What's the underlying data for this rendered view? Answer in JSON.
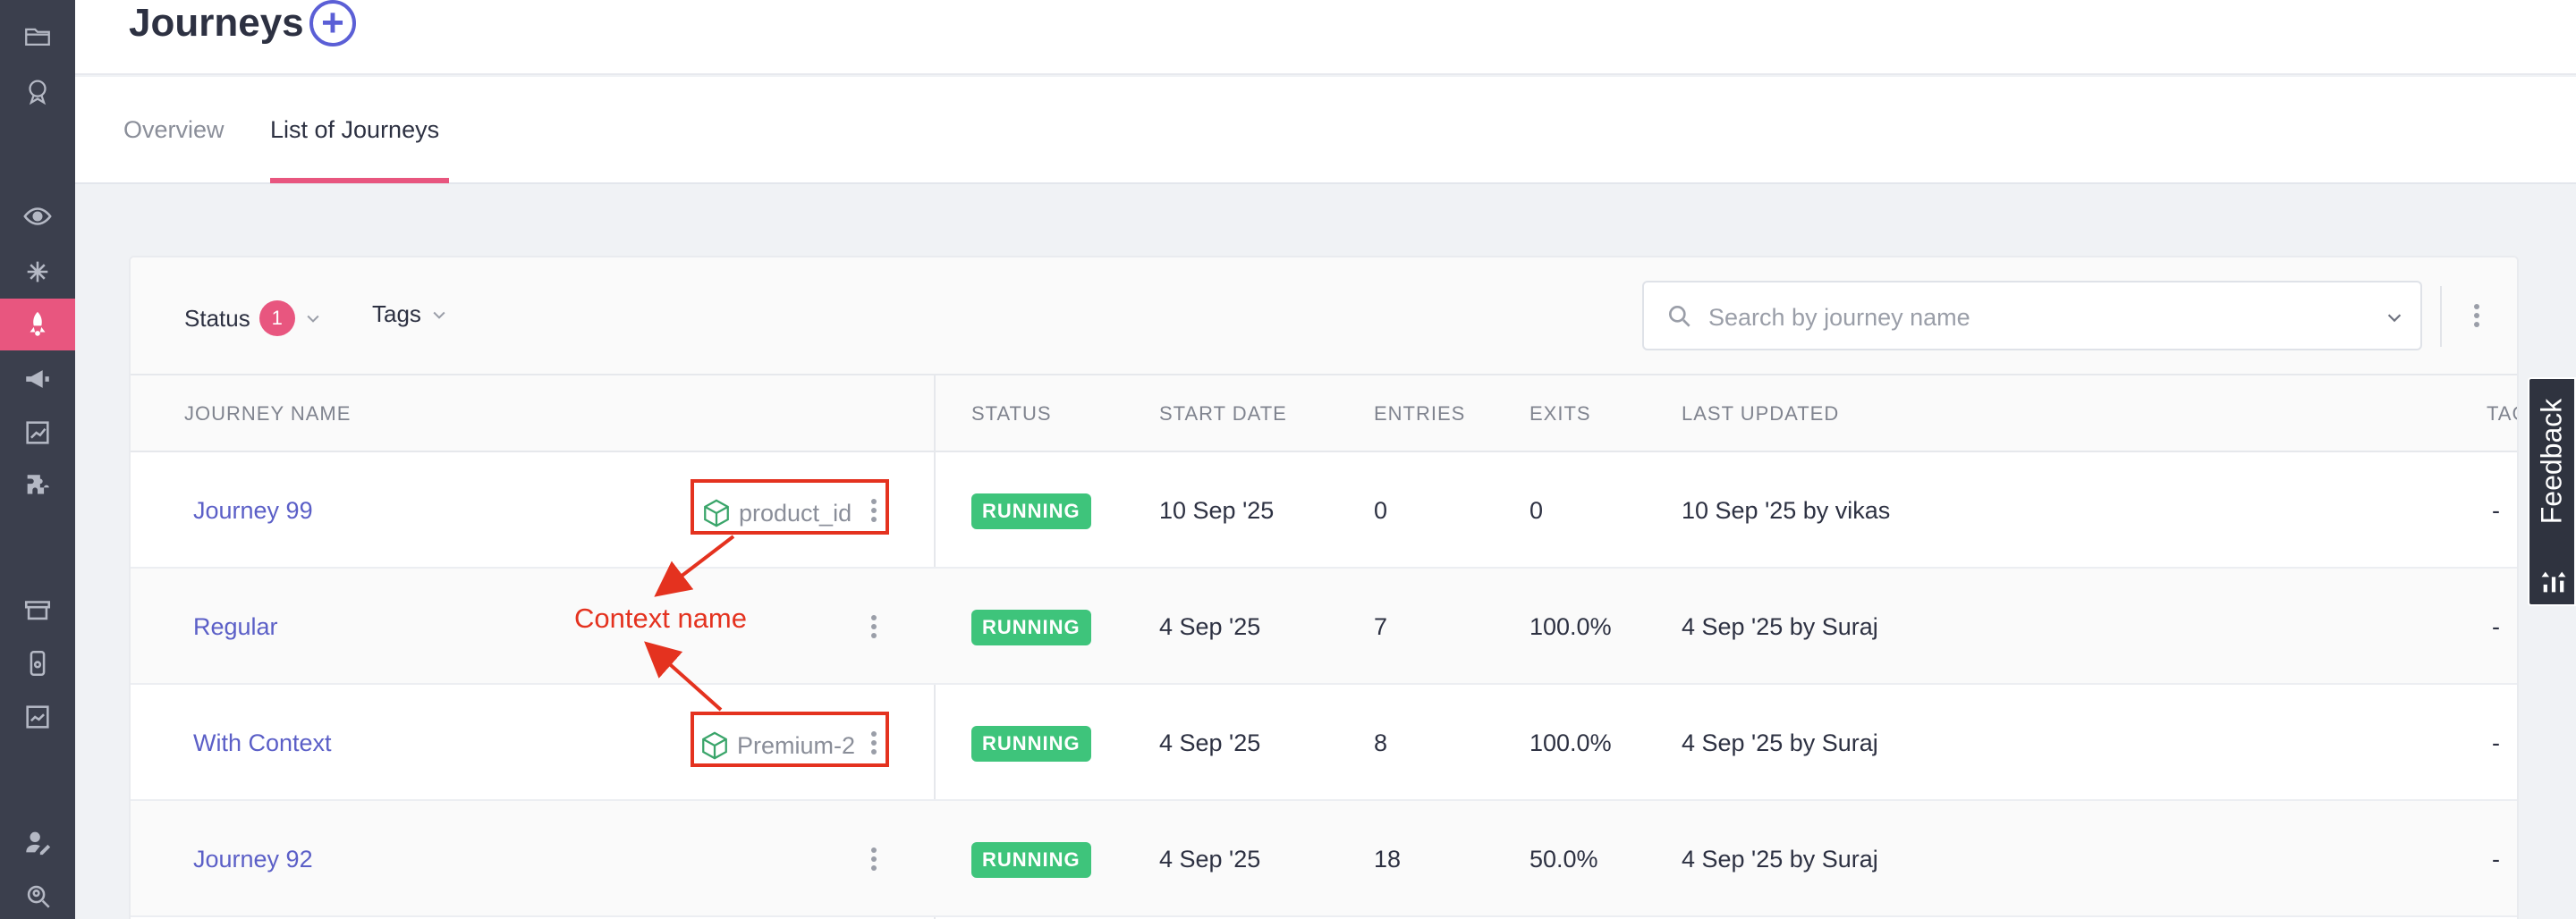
{
  "page": {
    "title": "Journeys"
  },
  "tabs": [
    {
      "label": "Overview"
    },
    {
      "label": "List of Journeys",
      "active": true
    }
  ],
  "filters": {
    "status_label": "Status",
    "status_count": "1",
    "tags_label": "Tags",
    "search_placeholder": "Search by journey name"
  },
  "table": {
    "headers": [
      "JOURNEY NAME",
      "STATUS",
      "START DATE",
      "ENTRIES",
      "EXITS",
      "LAST UPDATED",
      "TAG"
    ],
    "rows": [
      {
        "name": "Journey 99",
        "context": "product_id",
        "status": "RUNNING",
        "start_date": "10 Sep '25",
        "entries": "0",
        "exits": "0",
        "last_updated": "10 Sep '25 by vikas",
        "tags": "-"
      },
      {
        "name": "Regular",
        "context": "",
        "status": "RUNNING",
        "start_date": "4 Sep '25",
        "entries": "7",
        "exits": "100.0%",
        "last_updated": "4 Sep '25 by Suraj",
        "tags": "-"
      },
      {
        "name": "With Context",
        "context": "Premium-2",
        "status": "RUNNING",
        "start_date": "4 Sep '25",
        "entries": "8",
        "exits": "100.0%",
        "last_updated": "4 Sep '25 by Suraj",
        "tags": "-"
      },
      {
        "name": "Journey 92",
        "context": "",
        "status": "RUNNING",
        "start_date": "4 Sep '25",
        "entries": "18",
        "exits": "50.0%",
        "last_updated": "4 Sep '25 by Suraj",
        "tags": "-"
      }
    ]
  },
  "annotation": {
    "label": "Context name",
    "color": "#e4321f"
  },
  "feedback": {
    "label": "Feedback"
  },
  "colors": {
    "accent": "#e8567f",
    "link": "#5b5fc7",
    "running": "#3ec47b",
    "sidebar": "#3b3f4d"
  },
  "sidebar_icons": [
    "folder-icon",
    "badge-icon",
    "eye-icon",
    "sparkle-icon",
    "rocket-icon",
    "megaphone-icon",
    "chart-icon",
    "puzzle-icon",
    "store-icon",
    "phone-icon",
    "report-icon",
    "user-edit-icon",
    "search-user-icon"
  ]
}
